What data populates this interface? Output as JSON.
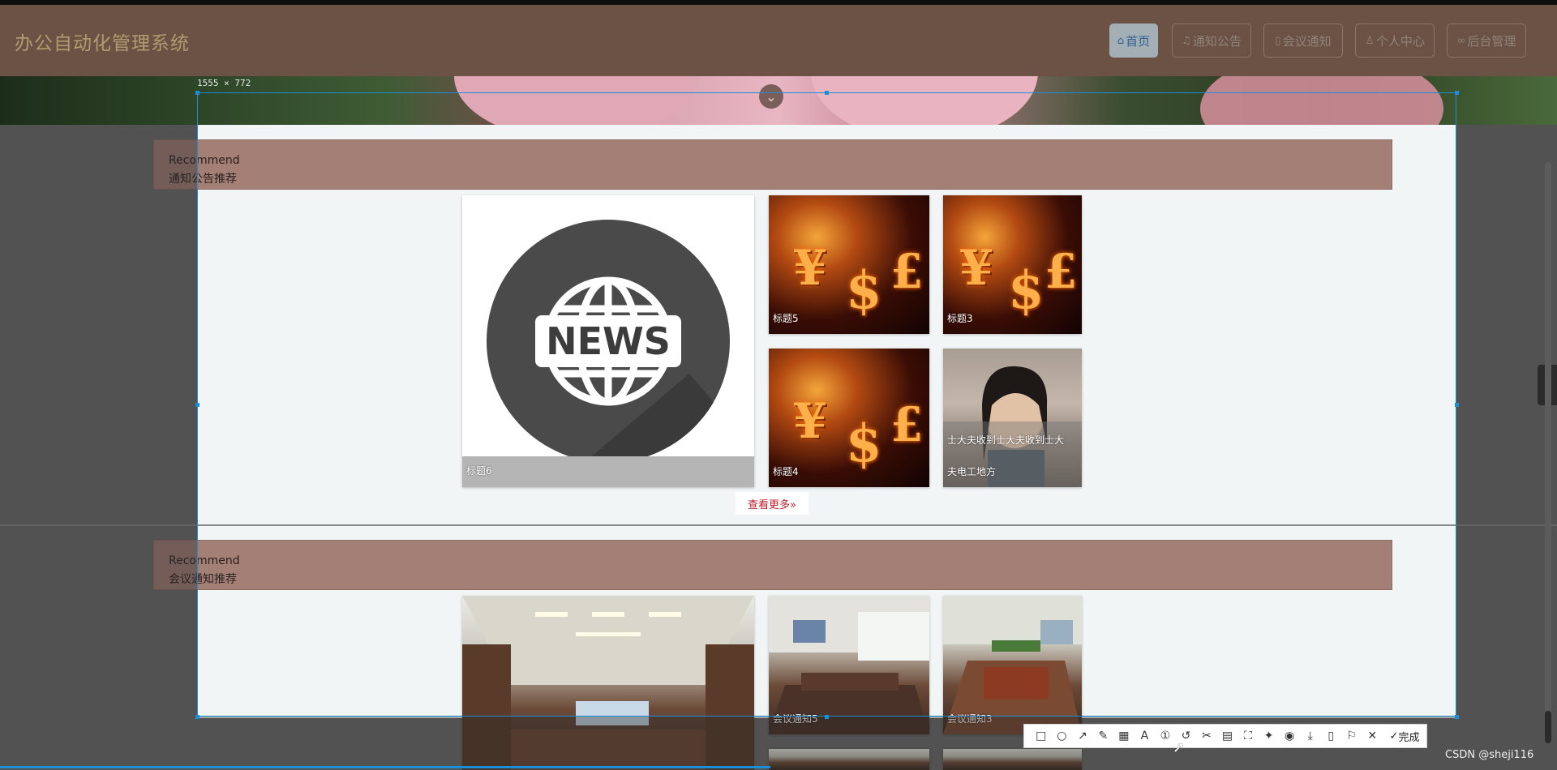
{
  "header": {
    "brand": "办公自动化管理系统",
    "nav": [
      {
        "label": "首页",
        "icon": "home-icon",
        "active": true
      },
      {
        "label": "通知公告",
        "icon": "bell-icon",
        "active": false
      },
      {
        "label": "会议通知",
        "icon": "document-icon",
        "active": false
      },
      {
        "label": "个人中心",
        "icon": "user-icon",
        "active": false
      },
      {
        "label": "后台管理",
        "icon": "link-icon",
        "active": false
      }
    ]
  },
  "capture": {
    "dimensions": "1555 × 772"
  },
  "sections": [
    {
      "en": "Recommend",
      "cn": "通知公告推荐",
      "cards": [
        {
          "title": "标题6",
          "image": "news-globe"
        },
        {
          "title": "标题5",
          "image": "currency-symbols"
        },
        {
          "title": "标题3",
          "image": "currency-symbols"
        },
        {
          "title": "标题4",
          "image": "currency-symbols"
        },
        {
          "title": "士大夫收到士大夫收到士大夫电工地方",
          "title_line1": "士大夫收到士大夫收到士大",
          "title_line2": "夫电工地方",
          "image": "portrait-woman"
        }
      ],
      "more": "查看更多»"
    },
    {
      "en": "Recommend",
      "cn": "会议通知推荐",
      "cards": [
        {
          "title": "",
          "image": "meeting-room"
        },
        {
          "title": "会议通知5",
          "image": "meeting-room"
        },
        {
          "title": "会议通知3",
          "image": "meeting-room"
        }
      ]
    }
  ],
  "toolbar": {
    "tools": [
      "rectangle-icon",
      "ellipse-icon",
      "arrow-icon",
      "pen-icon",
      "mosaic-icon",
      "text-icon",
      "number-icon",
      "undo-icon",
      "clip-icon",
      "ocr-icon",
      "fullscreen-icon",
      "pin-icon",
      "record-icon",
      "save-icon",
      "long-screenshot-icon",
      "bookmark-icon",
      "close-icon"
    ],
    "done_label": "完成"
  },
  "watermark": "CSDN @sheji116",
  "colors": {
    "header_bg": "#6c5244",
    "section_bar": "#a47f76",
    "selection_border": "#1a8fd8",
    "more_link": "#c01d2b"
  }
}
